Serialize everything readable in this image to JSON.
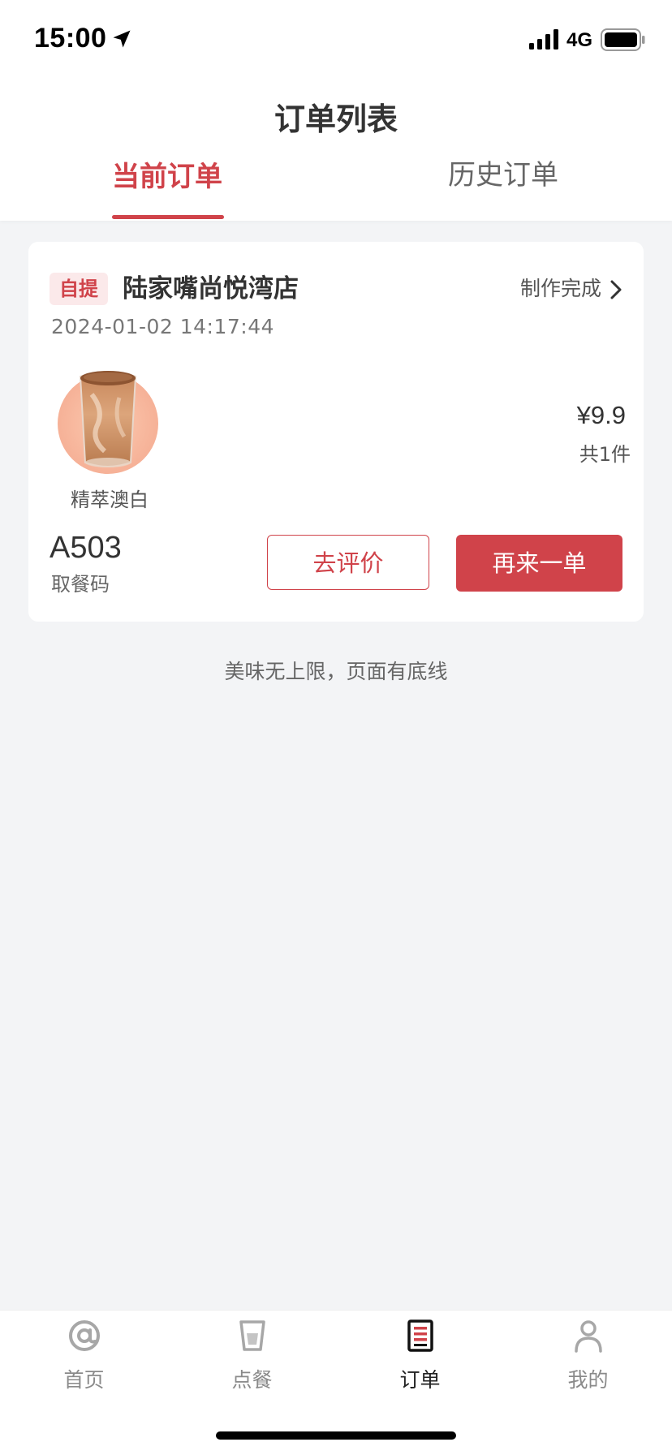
{
  "status_bar": {
    "time": "15:00",
    "network": "4G"
  },
  "header": {
    "title": "订单列表",
    "tabs": [
      {
        "label": "当前订单",
        "active": true
      },
      {
        "label": "历史订单",
        "active": false
      }
    ]
  },
  "order": {
    "badge": "自提",
    "store": "陆家嘴尚悦湾店",
    "status": "制作完成",
    "time": "2024-01-02 14:17:44",
    "product_name": "精萃澳白",
    "price": "¥9.9",
    "count": "共1件",
    "pickup_code": "A503",
    "pickup_code_label": "取餐码",
    "review_label": "去评价",
    "reorder_label": "再来一单"
  },
  "footer_note": "美味无上限，页面有底线",
  "bottom_nav": [
    {
      "label": "首页",
      "icon": "home-at-icon",
      "active": false
    },
    {
      "label": "点餐",
      "icon": "cup-icon",
      "active": false
    },
    {
      "label": "订单",
      "icon": "order-list-icon",
      "active": true
    },
    {
      "label": "我的",
      "icon": "user-icon",
      "active": false
    }
  ],
  "colors": {
    "accent": "#d0434a",
    "background": "#f3f4f6"
  }
}
